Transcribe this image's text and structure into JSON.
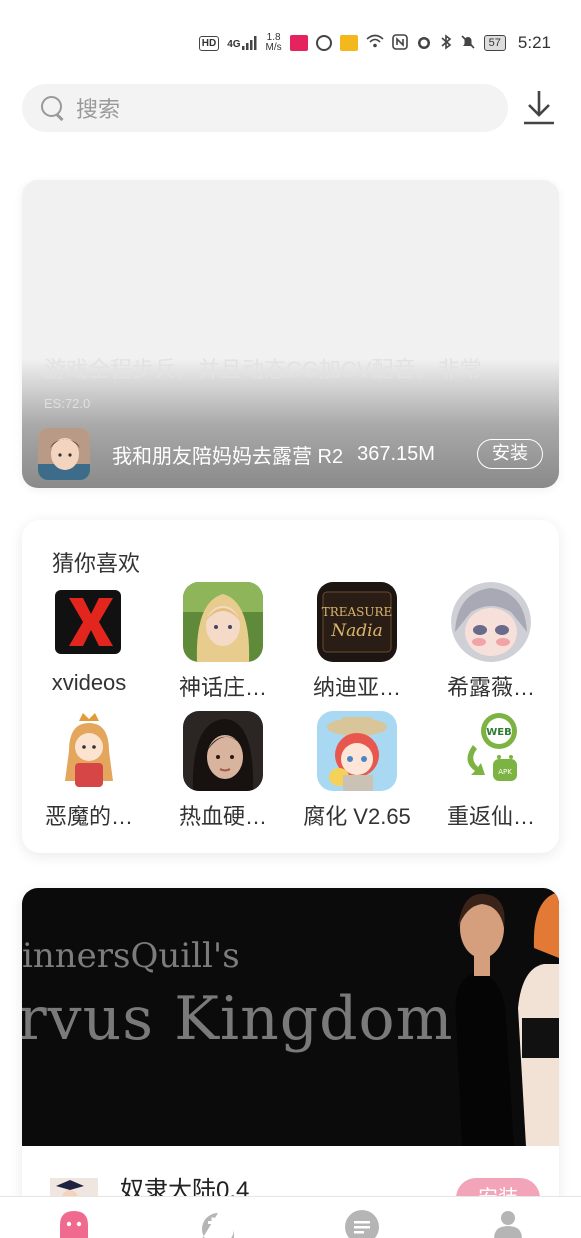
{
  "status_bar": {
    "hd": "HD",
    "signal": "4G",
    "speed_value": "1.8",
    "speed_unit": "M/s",
    "battery": "57",
    "time": "5:21"
  },
  "search": {
    "placeholder": "搜索"
  },
  "featured": {
    "description": "游戏全程步兵，并且动态CG加CV配音。非常",
    "sub": "ES:72.0",
    "title": "我和朋友陪妈妈去露营 R2",
    "size": "367.15M",
    "install_label": "安装"
  },
  "recommend": {
    "title": "猜你喜欢",
    "apps": [
      {
        "name": "xvideos",
        "icon": "xvideos-icon"
      },
      {
        "name": "神话庄…",
        "icon": "myth-estate-icon"
      },
      {
        "name": "纳迪亚…",
        "icon": "treasure-nadia-icon"
      },
      {
        "name": "希露薇…",
        "icon": "sylvie-icon"
      },
      {
        "name": "恶魔的…",
        "icon": "demon-girl-icon"
      },
      {
        "name": "热血硬…",
        "icon": "hot-blood-icon"
      },
      {
        "name": "腐化 V2.65",
        "icon": "corruption-icon"
      },
      {
        "name": "重返仙…",
        "icon": "web-apk-icon"
      }
    ]
  },
  "game": {
    "banner_line1": "innersQuill's",
    "banner_line2": "rvus Kingdom",
    "name": "奴隶大陆0.4",
    "install_label": "安装"
  },
  "bottom_nav": {
    "items": [
      "home-ghost-icon",
      "games-controller-icon",
      "feed-list-icon",
      "profile-person-icon"
    ]
  }
}
